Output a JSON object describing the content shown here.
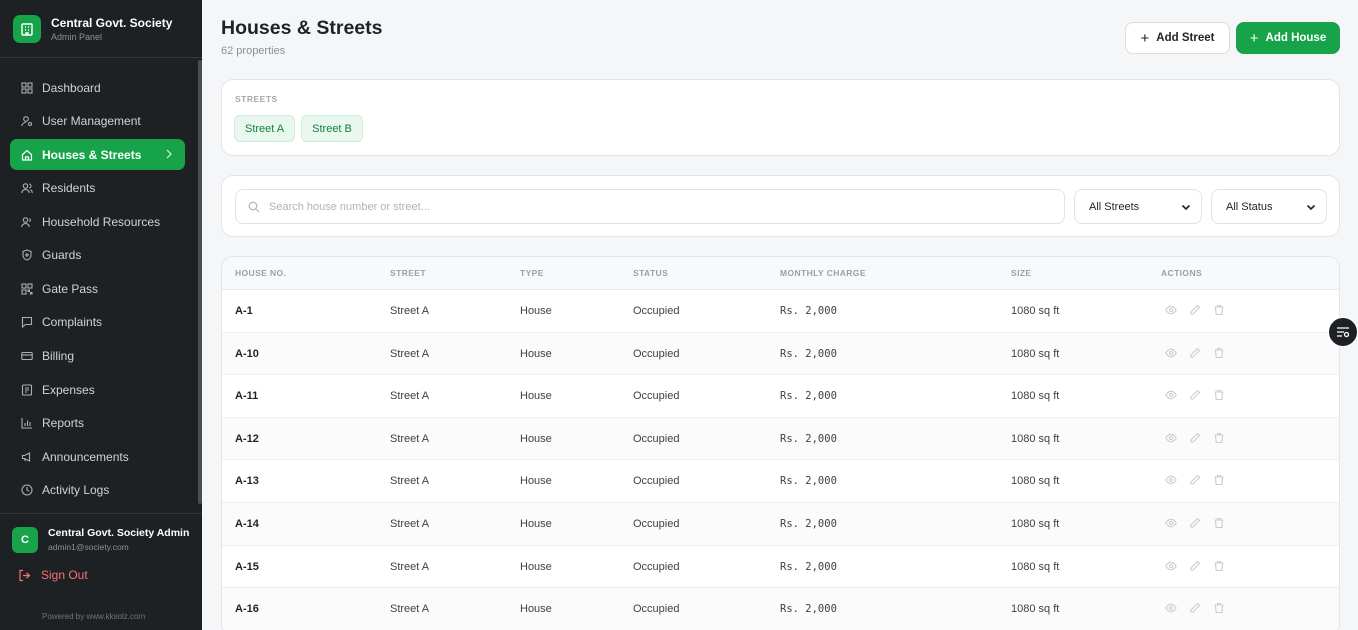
{
  "brand": {
    "name": "Central Govt. Society",
    "subtitle": "Admin Panel"
  },
  "nav": [
    {
      "label": "Dashboard",
      "icon": "dashboard-icon"
    },
    {
      "label": "User Management",
      "icon": "user-gear-icon"
    },
    {
      "label": "Houses & Streets",
      "icon": "home-icon",
      "active": true
    },
    {
      "label": "Residents",
      "icon": "users-icon"
    },
    {
      "label": "Household Resources",
      "icon": "user-icon"
    },
    {
      "label": "Guards",
      "icon": "shield-icon"
    },
    {
      "label": "Gate Pass",
      "icon": "qr-icon"
    },
    {
      "label": "Complaints",
      "icon": "message-icon"
    },
    {
      "label": "Billing",
      "icon": "card-icon"
    },
    {
      "label": "Expenses",
      "icon": "receipt-icon"
    },
    {
      "label": "Reports",
      "icon": "bar-chart-icon"
    },
    {
      "label": "Announcements",
      "icon": "megaphone-icon"
    },
    {
      "label": "Activity Logs",
      "icon": "clock-icon"
    }
  ],
  "user": {
    "initial": "C",
    "name": "Central Govt. Society Admin",
    "email": "admin1@society.com"
  },
  "signout": "Sign Out",
  "powered_by": "Powered by www.kksolz.com",
  "header": {
    "title": "Houses & Streets",
    "subtitle": "62 properties",
    "add_street": "Add Street",
    "add_house": "Add House"
  },
  "streets": {
    "label": "STREETS",
    "chips": [
      "Street A",
      "Street B"
    ]
  },
  "filters": {
    "search_placeholder": "Search house number or street...",
    "street_select": "All Streets",
    "status_select": "All Status"
  },
  "table": {
    "headers": [
      "HOUSE NO.",
      "STREET",
      "TYPE",
      "STATUS",
      "MONTHLY CHARGE",
      "SIZE",
      "ACTIONS"
    ],
    "rows": [
      {
        "house": "A-1",
        "street": "Street A",
        "type": "House",
        "status": "Occupied",
        "charge": "Rs. 2,000",
        "size": "1080 sq ft"
      },
      {
        "house": "A-10",
        "street": "Street A",
        "type": "House",
        "status": "Occupied",
        "charge": "Rs. 2,000",
        "size": "1080 sq ft"
      },
      {
        "house": "A-11",
        "street": "Street A",
        "type": "House",
        "status": "Occupied",
        "charge": "Rs. 2,000",
        "size": "1080 sq ft"
      },
      {
        "house": "A-12",
        "street": "Street A",
        "type": "House",
        "status": "Occupied",
        "charge": "Rs. 2,000",
        "size": "1080 sq ft"
      },
      {
        "house": "A-13",
        "street": "Street A",
        "type": "House",
        "status": "Occupied",
        "charge": "Rs. 2,000",
        "size": "1080 sq ft"
      },
      {
        "house": "A-14",
        "street": "Street A",
        "type": "House",
        "status": "Occupied",
        "charge": "Rs. 2,000",
        "size": "1080 sq ft"
      },
      {
        "house": "A-15",
        "street": "Street A",
        "type": "House",
        "status": "Occupied",
        "charge": "Rs. 2,000",
        "size": "1080 sq ft"
      },
      {
        "house": "A-16",
        "street": "Street A",
        "type": "House",
        "status": "Occupied",
        "charge": "Rs. 2,000",
        "size": "1080 sq ft"
      }
    ]
  },
  "colors": {
    "accent": "#16a34a",
    "sidebar_bg": "#1e2124",
    "danger": "#f87171"
  }
}
